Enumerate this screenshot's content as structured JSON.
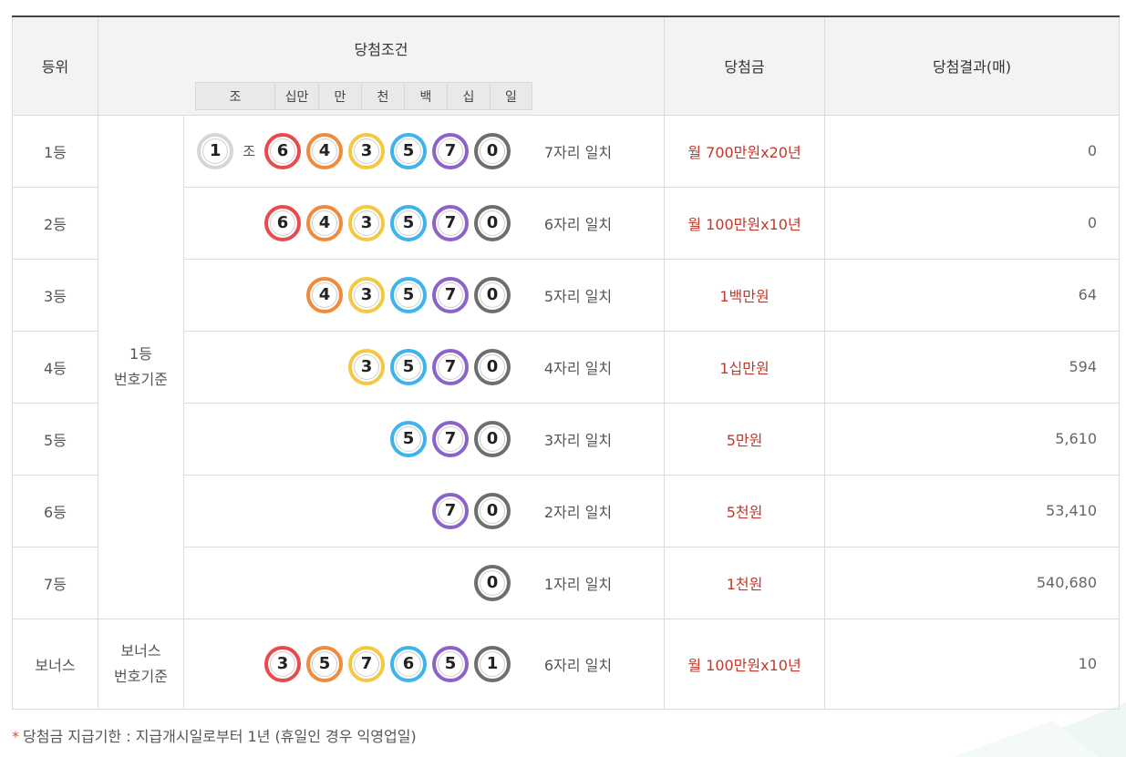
{
  "header": {
    "rank": "등위",
    "condition": "당첨조건",
    "prize": "당첨금",
    "result": "당첨결과(매)",
    "places": [
      "조",
      "십만",
      "만",
      "천",
      "백",
      "십",
      "일"
    ]
  },
  "basis": {
    "main": [
      "1등",
      "번호기준"
    ],
    "bonus": [
      "보너스",
      "번호기준"
    ]
  },
  "group_unit": "조",
  "colors": {
    "red": "#e94b4b",
    "orange": "#f28a3c",
    "yellow": "#f5c842",
    "blue": "#3db4ea",
    "purple": "#8b63c9",
    "gray": "#6e6e6e",
    "white": "#d6d6d6",
    "prize_text": "#c0392b",
    "note_star": "#e74c3c"
  },
  "rows": [
    {
      "rank": "1등",
      "group": "1",
      "balls": [
        {
          "n": "6",
          "color": "red"
        },
        {
          "n": "4",
          "color": "orange"
        },
        {
          "n": "3",
          "color": "yellow"
        },
        {
          "n": "5",
          "color": "blue"
        },
        {
          "n": "7",
          "color": "purple"
        },
        {
          "n": "0",
          "color": "gray"
        }
      ],
      "match": "7자리 일치",
      "prize": "월 700만원x20년",
      "count": "0"
    },
    {
      "rank": "2등",
      "balls": [
        {
          "n": "6",
          "color": "red"
        },
        {
          "n": "4",
          "color": "orange"
        },
        {
          "n": "3",
          "color": "yellow"
        },
        {
          "n": "5",
          "color": "blue"
        },
        {
          "n": "7",
          "color": "purple"
        },
        {
          "n": "0",
          "color": "gray"
        }
      ],
      "match": "6자리 일치",
      "prize": "월 100만원x10년",
      "count": "0"
    },
    {
      "rank": "3등",
      "balls": [
        {
          "n": "4",
          "color": "orange"
        },
        {
          "n": "3",
          "color": "yellow"
        },
        {
          "n": "5",
          "color": "blue"
        },
        {
          "n": "7",
          "color": "purple"
        },
        {
          "n": "0",
          "color": "gray"
        }
      ],
      "match": "5자리 일치",
      "prize": "1백만원",
      "count": "64"
    },
    {
      "rank": "4등",
      "balls": [
        {
          "n": "3",
          "color": "yellow"
        },
        {
          "n": "5",
          "color": "blue"
        },
        {
          "n": "7",
          "color": "purple"
        },
        {
          "n": "0",
          "color": "gray"
        }
      ],
      "match": "4자리 일치",
      "prize": "1십만원",
      "count": "594"
    },
    {
      "rank": "5등",
      "balls": [
        {
          "n": "5",
          "color": "blue"
        },
        {
          "n": "7",
          "color": "purple"
        },
        {
          "n": "0",
          "color": "gray"
        }
      ],
      "match": "3자리 일치",
      "prize": "5만원",
      "count": "5,610"
    },
    {
      "rank": "6등",
      "balls": [
        {
          "n": "7",
          "color": "purple"
        },
        {
          "n": "0",
          "color": "gray"
        }
      ],
      "match": "2자리 일치",
      "prize": "5천원",
      "count": "53,410"
    },
    {
      "rank": "7등",
      "balls": [
        {
          "n": "0",
          "color": "gray"
        }
      ],
      "match": "1자리 일치",
      "prize": "1천원",
      "count": "540,680"
    },
    {
      "rank": "보너스",
      "balls": [
        {
          "n": "3",
          "color": "red"
        },
        {
          "n": "5",
          "color": "orange"
        },
        {
          "n": "7",
          "color": "yellow"
        },
        {
          "n": "6",
          "color": "blue"
        },
        {
          "n": "5",
          "color": "purple"
        },
        {
          "n": "1",
          "color": "gray"
        }
      ],
      "match": "6자리 일치",
      "prize": "월 100만원x10년",
      "count": "10"
    }
  ],
  "note": {
    "star": "*",
    "text": "당첨금 지급기한 : 지급개시일로부터 1년 (휴일인 경우 익영업일)"
  }
}
